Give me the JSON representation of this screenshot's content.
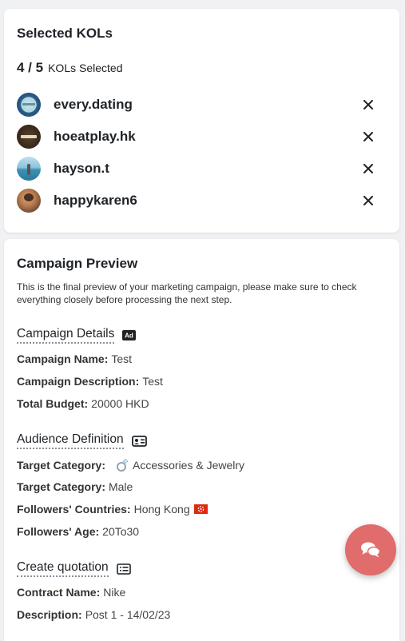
{
  "selected_kols": {
    "title": "Selected KOLs",
    "count": "4 / 5",
    "count_label": "KOLs Selected",
    "items": [
      {
        "name": "every.dating"
      },
      {
        "name": "hoeatplay.hk"
      },
      {
        "name": "hayson.t"
      },
      {
        "name": "happykaren6"
      }
    ]
  },
  "preview": {
    "title": "Campaign Preview",
    "description": "This is the final preview of your marketing campaign, please make sure to check everything closely before processing the next step.",
    "campaign_details": {
      "title": "Campaign Details",
      "icon": "ad-icon",
      "fields": [
        {
          "label": "Campaign Name:",
          "value": "Test"
        },
        {
          "label": "Campaign Description:",
          "value": "Test"
        },
        {
          "label": "Total Budget:",
          "value": "20000 HKD"
        }
      ]
    },
    "audience": {
      "title": "Audience Definition",
      "icon": "id-card-icon",
      "fields": [
        {
          "label": "Target Category:",
          "value": "Accessories & Jewelry",
          "icon": "ring-emoji"
        },
        {
          "label": "Target Category:",
          "value": "Male"
        },
        {
          "label": "Followers' Countries:",
          "value": "Hong Kong",
          "icon": "hong-kong-flag"
        },
        {
          "label": "Followers' Age:",
          "value": "20To30"
        }
      ]
    },
    "quotation": {
      "title": "Create quotation",
      "icon": "list-icon",
      "fields": [
        {
          "label": "Contract Name:",
          "value": "Nike"
        },
        {
          "label": "Description:",
          "value": "Post 1 - 14/02/23"
        }
      ]
    }
  },
  "colors": {
    "fab": "#e06c6c",
    "background": "#f0f1f3",
    "card": "#ffffff",
    "flag_red": "#de2910"
  }
}
